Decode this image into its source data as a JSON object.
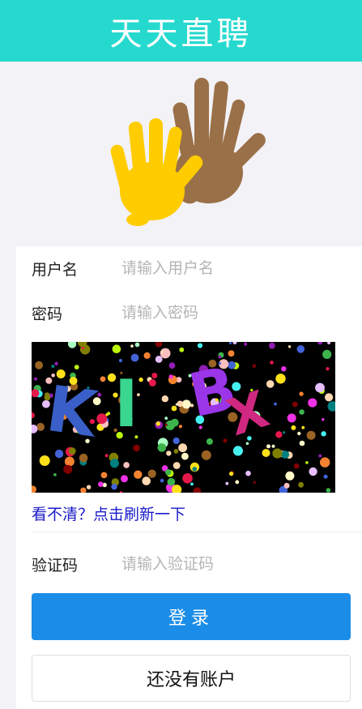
{
  "header": {
    "title": "天天直聘"
  },
  "logo": {
    "icon": "handprints-icon",
    "colors": {
      "left_hand": "#ffcc00",
      "right_hand": "#9a7048"
    }
  },
  "form": {
    "username": {
      "label": "用户名",
      "placeholder": "请输入用户名"
    },
    "password": {
      "label": "密码",
      "placeholder": "请输入密码"
    },
    "captcha_image": {
      "letters": [
        "K",
        "I",
        "B",
        "X"
      ]
    },
    "refresh_link": "看不清？点击刷新一下",
    "captcha": {
      "label": "验证码",
      "placeholder": "请输入验证码"
    },
    "login_button": "登录",
    "register_button": "还没有账户"
  },
  "colors": {
    "header_bg": "#26d9cf",
    "login_bg": "#1b8de8",
    "link": "#1a1acb"
  }
}
